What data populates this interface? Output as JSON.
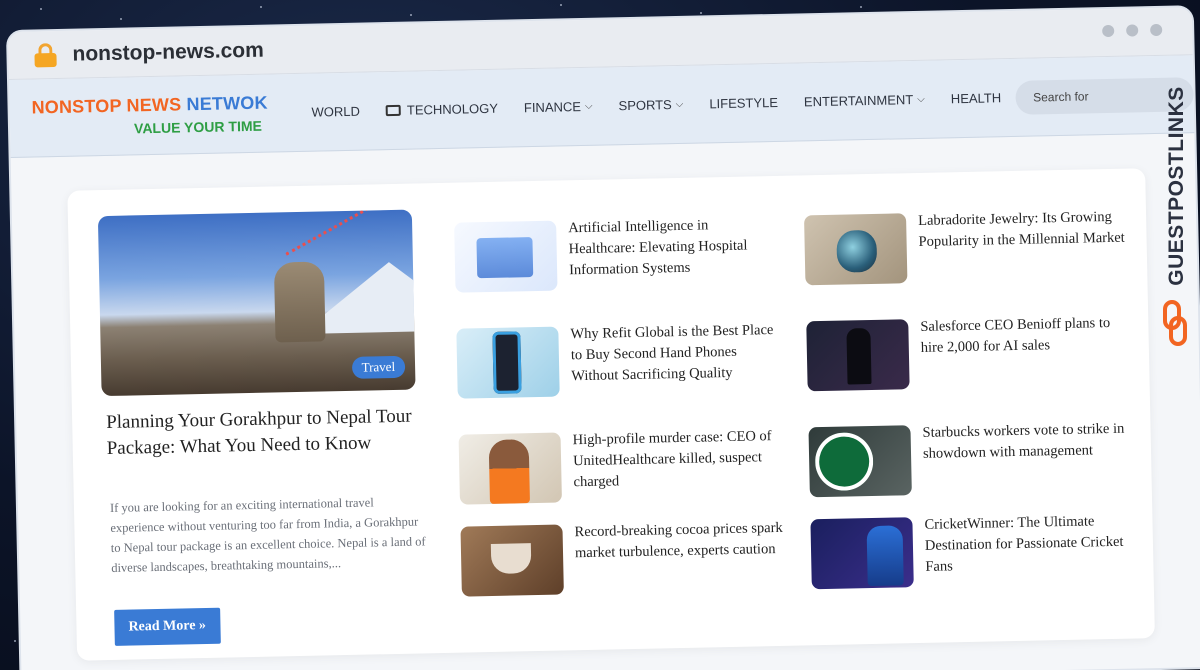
{
  "browser": {
    "url": "nonstop-news.com"
  },
  "site": {
    "brand_part1": "NONSTOP NEWS ",
    "brand_part2": "NETWOK",
    "tagline": "VALUE YOUR TIME",
    "colors": {
      "brand_orange": "#f26522",
      "brand_blue": "#3a7bd5",
      "tagline_green": "#2e9e44"
    }
  },
  "nav": {
    "items": [
      {
        "label": "WORLD",
        "icon": null,
        "dropdown": false
      },
      {
        "label": "TECHNOLOGY",
        "icon": "laptop-icon",
        "dropdown": false
      },
      {
        "label": "FINANCE",
        "icon": null,
        "dropdown": true
      },
      {
        "label": "SPORTS",
        "icon": null,
        "dropdown": true
      },
      {
        "label": "LIFESTYLE",
        "icon": null,
        "dropdown": false
      },
      {
        "label": "ENTERTAINMENT",
        "icon": null,
        "dropdown": true
      },
      {
        "label": "HEALTH",
        "icon": null,
        "dropdown": false
      }
    ],
    "search_placeholder": "Search for"
  },
  "featured": {
    "category": "Travel",
    "title": "Planning Your Gorakhpur to Nepal Tour Package: What You Need to Know",
    "excerpt": "If you are looking for an exciting international travel experience without venturing too far from India, a Gorakhpur to Nepal tour package is an excellent choice. Nepal is a land of diverse landscapes, breathtaking mountains,...",
    "read_more": "Read More »"
  },
  "posts_col1": [
    {
      "title": "Artificial Intelligence in Healthcare: Elevating Hospital Information Systems"
    },
    {
      "title": "Why Refit Global is the Best Place to Buy Second Hand Phones Without Sacrificing Quality"
    },
    {
      "title": "High-profile murder case: CEO of UnitedHealthcare killed, suspect charged"
    },
    {
      "title": "Record-breaking cocoa prices spark market turbulence, experts caution"
    }
  ],
  "posts_col2": [
    {
      "title": "Labradorite Jewelry: Its Growing Popularity in the Millennial Market"
    },
    {
      "title": "Salesforce CEO Benioff plans to hire 2,000 for AI sales"
    },
    {
      "title": "Starbucks workers vote to strike in showdown with management"
    },
    {
      "title": "CricketWinner: The Ultimate Destination for Passionate Cricket Fans"
    }
  ],
  "watermark": {
    "text": "GUESTPOSTLINKS"
  }
}
